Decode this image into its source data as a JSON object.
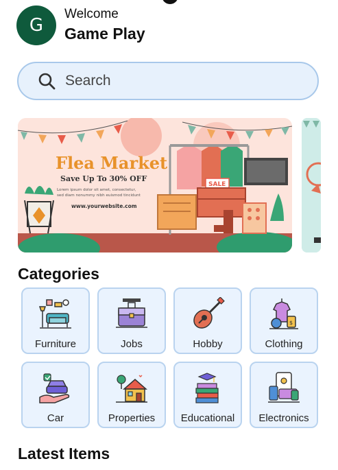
{
  "header": {
    "avatar_letter": "G",
    "welcome": "Welcome",
    "username": "Game Play"
  },
  "search": {
    "placeholder": "Search"
  },
  "banner": {
    "title": "Flea Market",
    "subtitle": "Save Up To 30% OFF",
    "body_line1": "Lorem ipsum dolor sit amet, consectetur,",
    "body_line2": "sed diam nonummy nibh euismod tincidunt",
    "website": "www.yourwebsite.com",
    "tag": "SALE"
  },
  "sections": {
    "categories": "Categories",
    "latest_items": "Latest Items"
  },
  "categories": [
    {
      "label": "Furniture",
      "icon": "sofa-icon"
    },
    {
      "label": "Jobs",
      "icon": "briefcase-icon"
    },
    {
      "label": "Hobby",
      "icon": "guitar-icon"
    },
    {
      "label": "Clothing",
      "icon": "clothing-icon"
    },
    {
      "label": "Car",
      "icon": "car-icon"
    },
    {
      "label": "Properties",
      "icon": "house-icon"
    },
    {
      "label": "Educational",
      "icon": "books-icon"
    },
    {
      "label": "Electronics",
      "icon": "devices-icon"
    }
  ],
  "colors": {
    "brand": "#0f5a3c",
    "search_bg": "#e7f1fc",
    "card_bg": "#eaf3fe",
    "card_border": "#b9d3ef",
    "banner_title": "#e8922a"
  }
}
